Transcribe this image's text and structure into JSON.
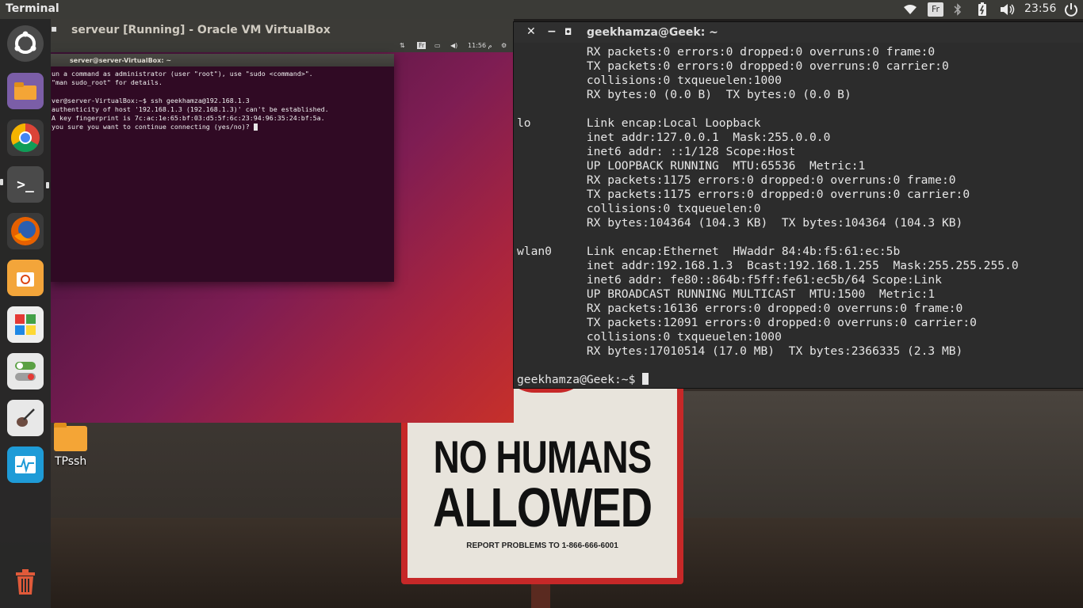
{
  "top_panel": {
    "app_title": "Terminal",
    "keyboard_layout": "Fr",
    "clock": "23:56"
  },
  "launcher": {
    "items": [
      {
        "name": "ubuntu-dash",
        "color": "#5a5a5a"
      },
      {
        "name": "files",
        "color": "#7b5ea7"
      },
      {
        "name": "chrome",
        "color": "#3a3a3a"
      },
      {
        "name": "terminal",
        "color": "#4a4a4a"
      },
      {
        "name": "firefox",
        "color": "#e66000"
      },
      {
        "name": "software-center",
        "color": "#f3a53a"
      },
      {
        "name": "app-grid",
        "color": "#eeeeee"
      },
      {
        "name": "toggle-settings",
        "color": "#5aa043"
      },
      {
        "name": "guitar-app",
        "color": "#e8e8e8"
      },
      {
        "name": "system-monitor",
        "color": "#1e9bd7"
      }
    ]
  },
  "vbox": {
    "title": "serveur [Running] - Oracle VM VirtualBox",
    "guest_panel": {
      "keyboard": "Fr",
      "clock": "11:56 م"
    },
    "guest_terminal": {
      "title": "server@server-VirtualBox: ~",
      "lines": [
        "un a command as administrator (user \"root\"), use \"sudo <command>\".",
        "\"man sudo_root\" for details.",
        "",
        "ver@server-VirtualBox:~$ ssh geekhamza@192.168.1.3",
        "authenticity of host '192.168.1.3 (192.168.1.3)' can't be established.",
        "A key fingerprint is 7c:ac:1e:65:bf:03:d5:5f:6c:23:94:96:35:24:bf:5a.",
        "you sure you want to continue connecting (yes/no)? "
      ]
    }
  },
  "desktop_icon": {
    "label": "TPssh"
  },
  "sign": {
    "line1": "NO HUMANS",
    "line2": "ALLOWED",
    "report": "REPORT PROBLEMS TO 1-866-666-6001"
  },
  "host_terminal": {
    "title": "geekhamza@Geek: ~",
    "lines": [
      "          RX packets:0 errors:0 dropped:0 overruns:0 frame:0",
      "          TX packets:0 errors:0 dropped:0 overruns:0 carrier:0",
      "          collisions:0 txqueuelen:1000",
      "          RX bytes:0 (0.0 B)  TX bytes:0 (0.0 B)",
      "",
      "lo        Link encap:Local Loopback",
      "          inet addr:127.0.0.1  Mask:255.0.0.0",
      "          inet6 addr: ::1/128 Scope:Host",
      "          UP LOOPBACK RUNNING  MTU:65536  Metric:1",
      "          RX packets:1175 errors:0 dropped:0 overruns:0 frame:0",
      "          TX packets:1175 errors:0 dropped:0 overruns:0 carrier:0",
      "          collisions:0 txqueuelen:0",
      "          RX bytes:104364 (104.3 KB)  TX bytes:104364 (104.3 KB)",
      "",
      "wlan0     Link encap:Ethernet  HWaddr 84:4b:f5:61:ec:5b",
      "          inet addr:192.168.1.3  Bcast:192.168.1.255  Mask:255.255.255.0",
      "          inet6 addr: fe80::864b:f5ff:fe61:ec5b/64 Scope:Link",
      "          UP BROADCAST RUNNING MULTICAST  MTU:1500  Metric:1",
      "          RX packets:16136 errors:0 dropped:0 overruns:0 frame:0",
      "          TX packets:12091 errors:0 dropped:0 overruns:0 carrier:0",
      "          collisions:0 txqueuelen:1000",
      "          RX bytes:17010514 (17.0 MB)  TX bytes:2366335 (2.3 MB)",
      ""
    ],
    "prompt": "geekhamza@Geek:~$ "
  }
}
